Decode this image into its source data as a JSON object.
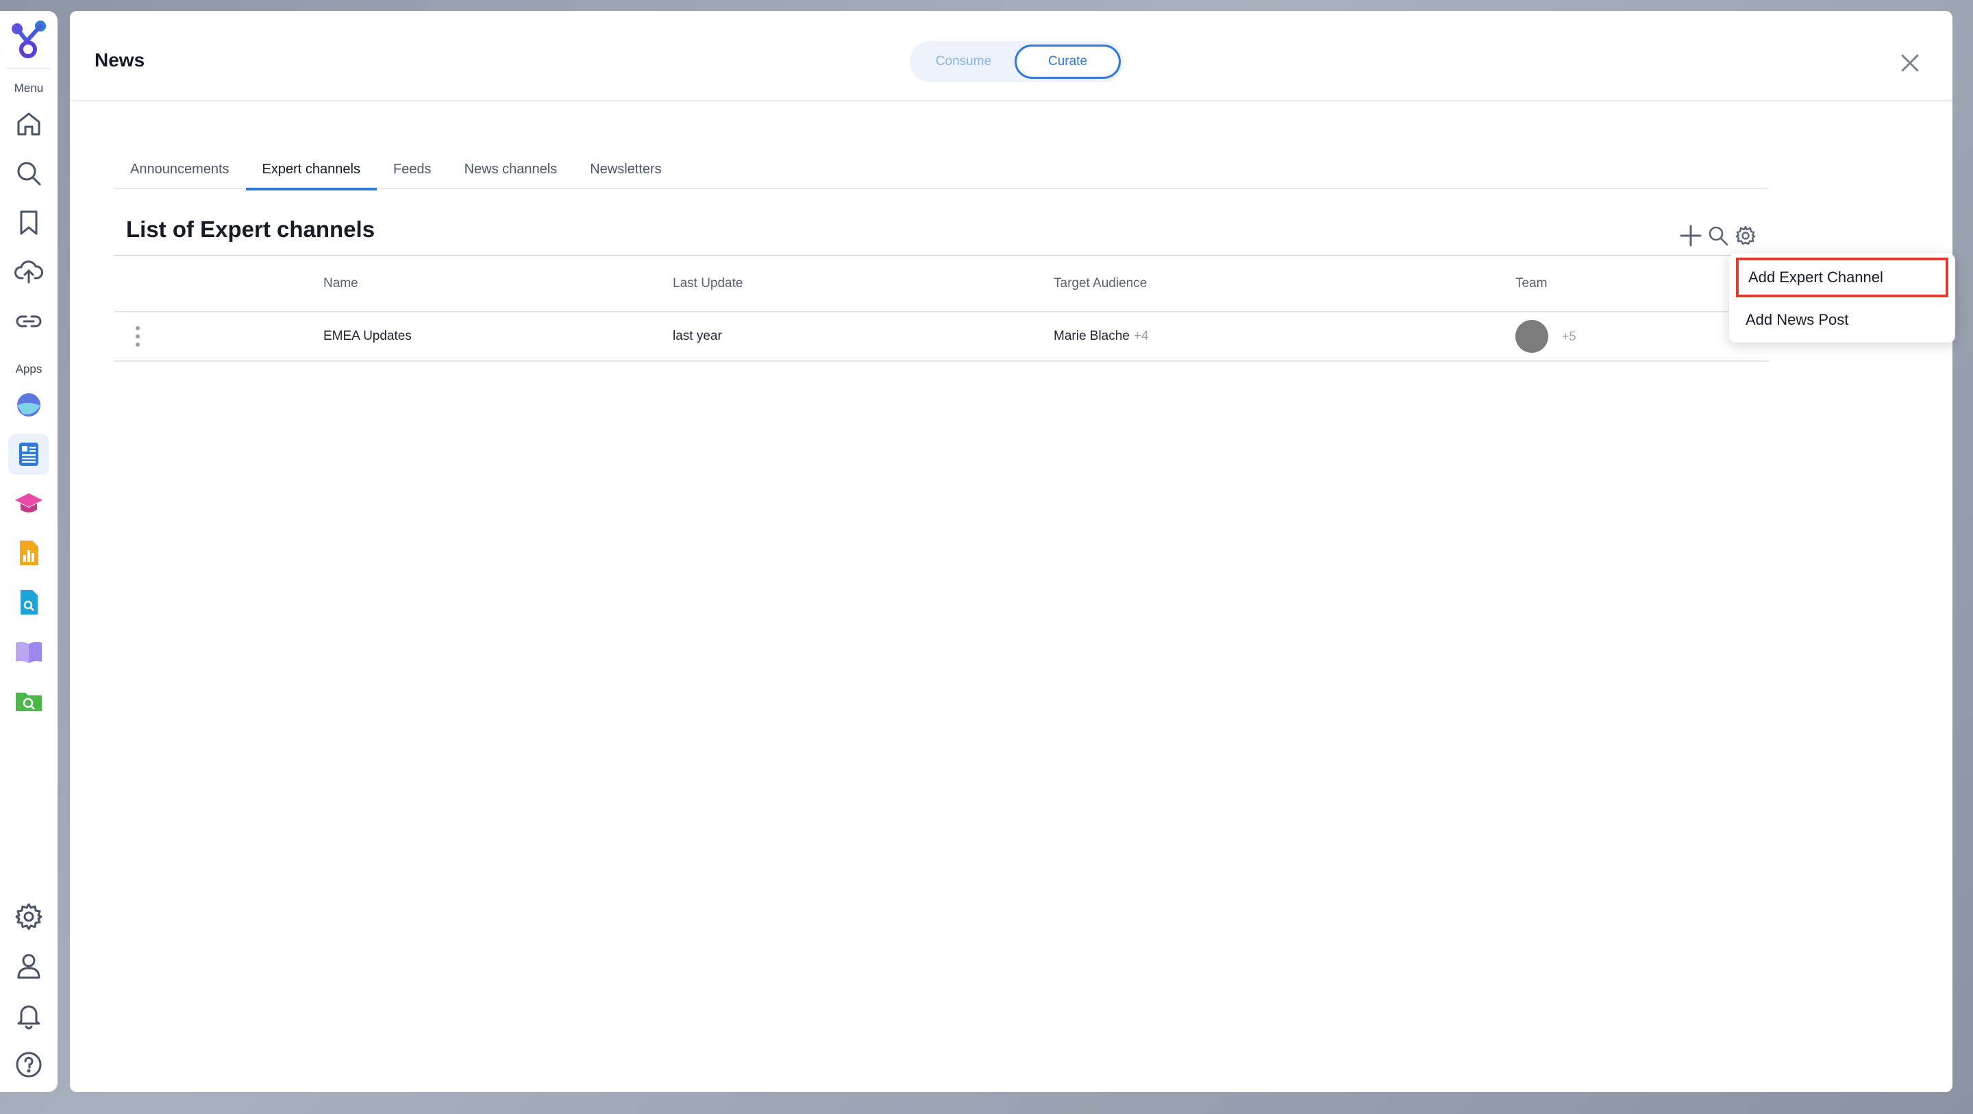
{
  "rail": {
    "menu_label": "Menu",
    "apps_label": "Apps",
    "nav_items": [
      "home-icon",
      "search-icon",
      "bookmark-icon",
      "upload-cloud-icon",
      "link-icon"
    ],
    "app_items": [
      "sphere-app-icon",
      "news-app-icon",
      "learning-app-icon",
      "analytics-app-icon",
      "document-search-app-icon",
      "book-app-icon",
      "folder-search-app-icon"
    ],
    "bottom_items": [
      "settings-icon",
      "user-icon",
      "bell-icon",
      "help-icon"
    ]
  },
  "header": {
    "title": "News",
    "toggle": {
      "options": [
        "Consume",
        "Curate"
      ],
      "selected": "Curate"
    }
  },
  "tabs": [
    {
      "label": "Announcements"
    },
    {
      "label": "Expert channels",
      "active": true
    },
    {
      "label": "Feeds"
    },
    {
      "label": "News channels"
    },
    {
      "label": "Newsletters"
    }
  ],
  "list": {
    "title": "List of Expert channels",
    "columns": [
      "Name",
      "Last Update",
      "Target Audience",
      "Team"
    ],
    "rows": [
      {
        "name": "EMEA Updates",
        "last_update": "last year",
        "audience": "Marie Blache",
        "audience_more": "+4",
        "team_more": "+5"
      }
    ]
  },
  "menu": {
    "items": [
      "Add Expert Channel",
      "Add News Post"
    ],
    "highlighted": "Add Expert Channel"
  },
  "colors": {
    "accent": "#2f7ad8",
    "highlight_border": "#e23a2e"
  }
}
